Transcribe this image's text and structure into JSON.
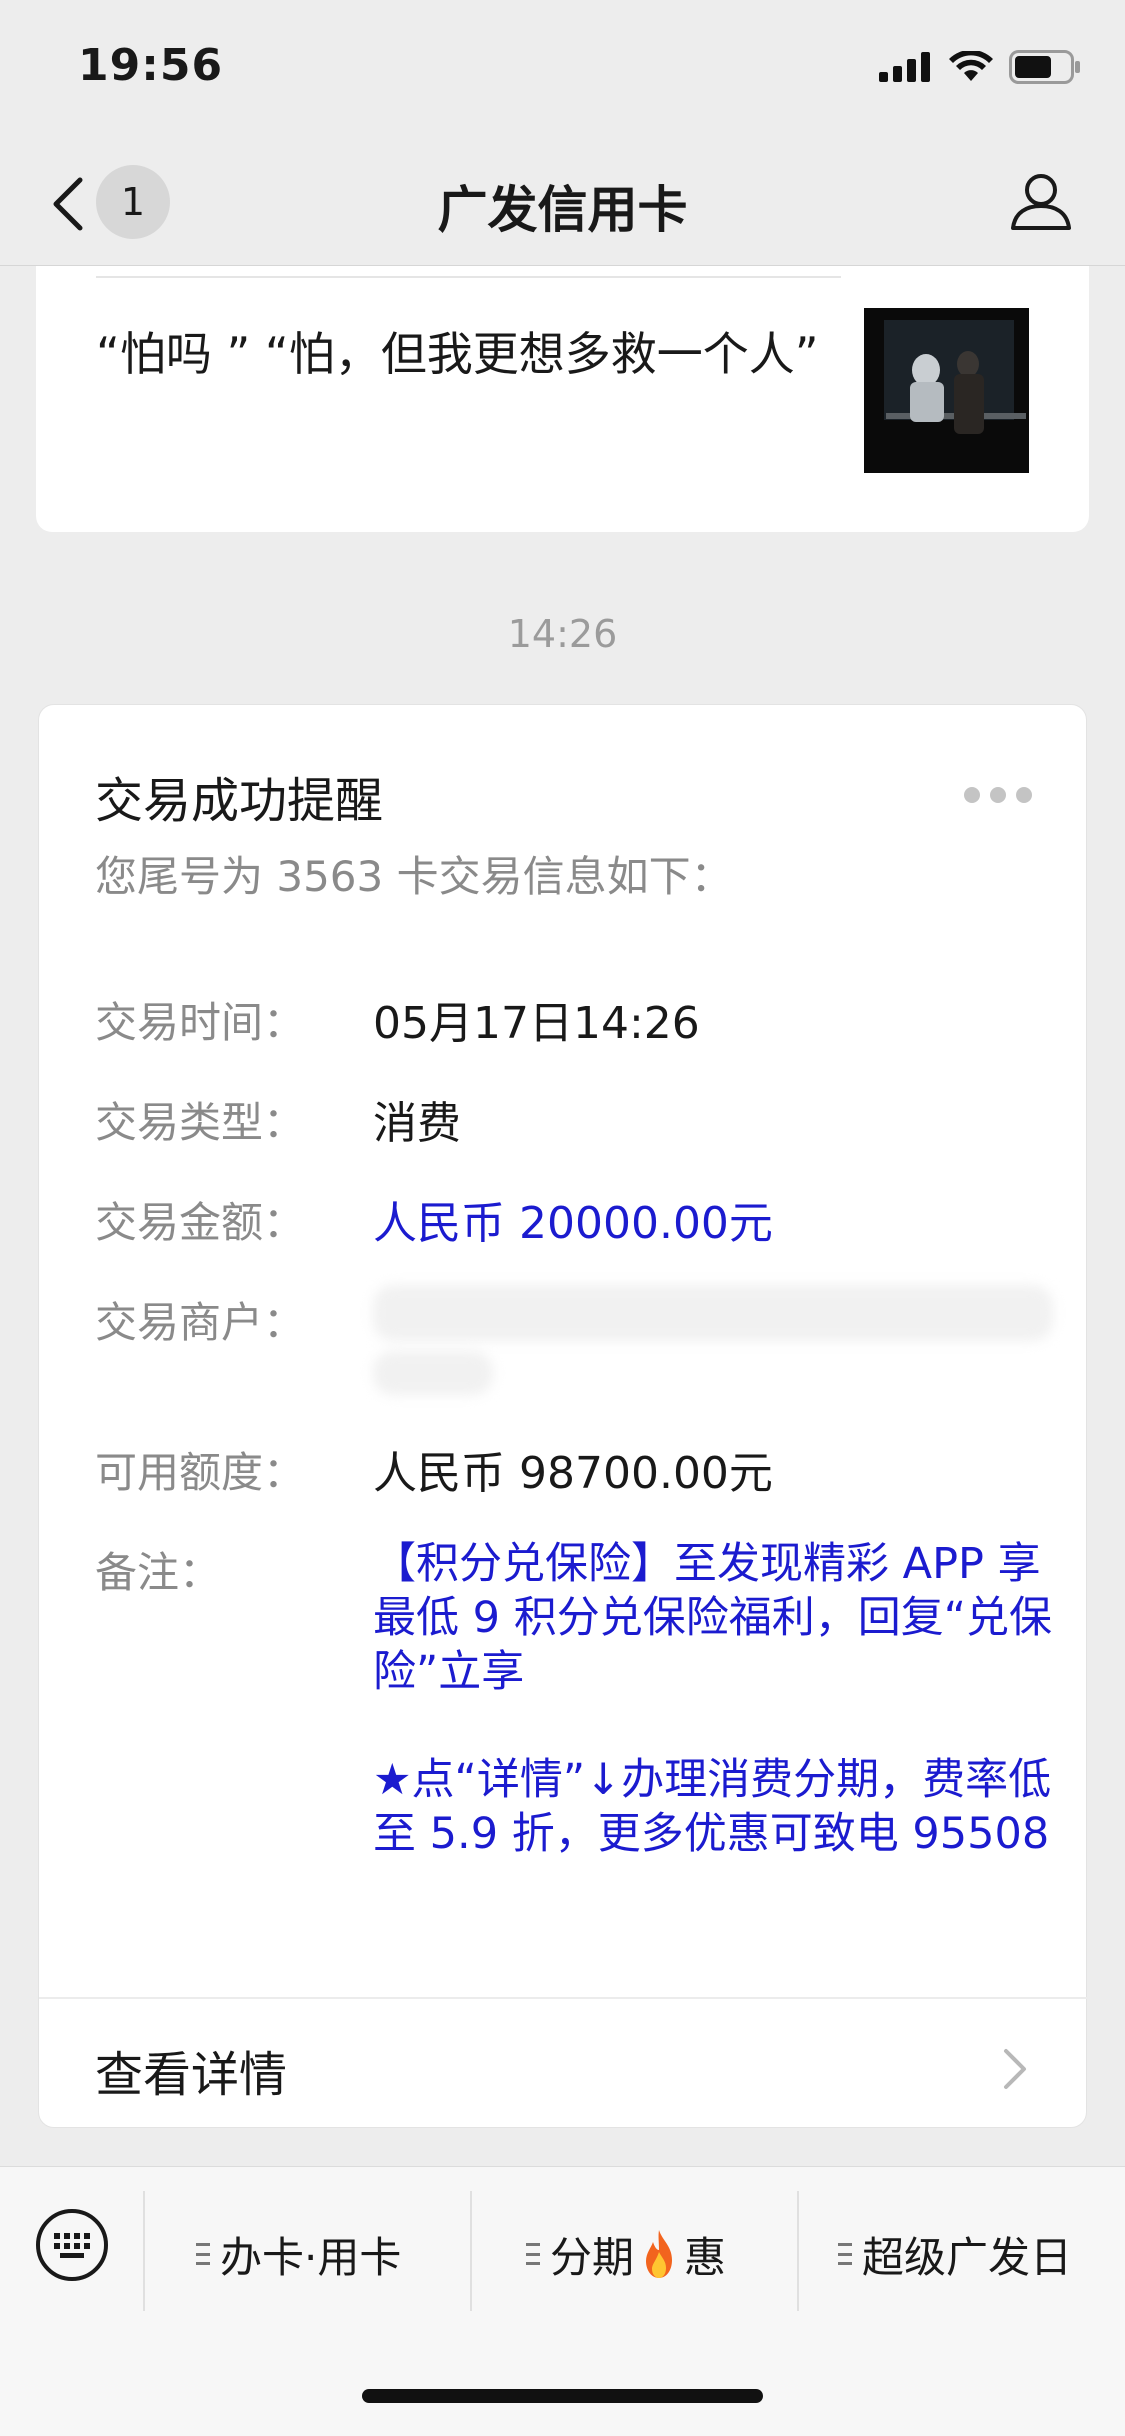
{
  "status_bar": {
    "time": "19:56"
  },
  "nav": {
    "unread_count": "1",
    "title": "广发信用卡"
  },
  "article": {
    "title": "“怕吗 ”  “怕，但我更想多救一个人”"
  },
  "timestamp": "14:26",
  "message": {
    "title": "交易成功提醒",
    "subtitle": "您尾号为 3563 卡交易信息如下：",
    "fields": [
      {
        "label": "交易时间：",
        "value": "05月17日14:26"
      },
      {
        "label": "交易类型：",
        "value": "消费"
      },
      {
        "label": "交易金额：",
        "value": "人民币 20000.00元"
      },
      {
        "label": "交易商户：",
        "value": ""
      },
      {
        "label": "可用额度：",
        "value": "人民币 98700.00元"
      },
      {
        "label": "备注：",
        "value": ""
      }
    ],
    "remark": [
      "【积分兑保险】至发现精彩 APP 享最低 9 积分兑保险福利，回复“兑保险”立享",
      "★点“详情”↓办理消费分期，费率低至 5.9 折，更多优惠可致电 95508"
    ],
    "detail_link": "查看详情"
  },
  "bottom_menu": {
    "items": [
      {
        "label": "办卡·用卡"
      },
      {
        "label_before": "分期",
        "label_after": "惠",
        "icon": "fire-icon"
      },
      {
        "label": "超级广发日"
      }
    ]
  },
  "colors": {
    "accent_blue": "#1b1bcf",
    "label_gray": "#8a8a8a",
    "background": "#ededed"
  }
}
